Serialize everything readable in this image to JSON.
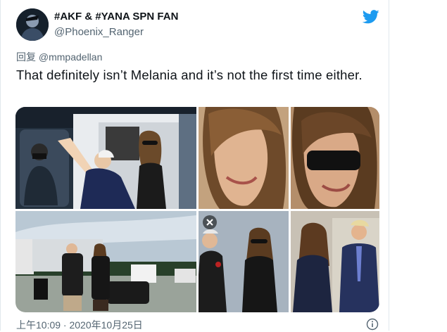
{
  "tweet": {
    "display_name": "#AKF & #YANA SPN FAN",
    "handle": "@Phoenix_Ranger",
    "reply_prefix": "回复",
    "reply_to": "@mmpadellan",
    "text": "That definitely isn’t Melania and it’s not the first time either.",
    "timestamp": "上午10:09 · 2020年10月25日"
  },
  "icons": {
    "brand": "twitter-bird-icon",
    "info": "info-icon",
    "remove": "close-icon"
  },
  "colors": {
    "twitter_blue": "#1d9bf0",
    "secondary_text": "#536471",
    "primary_text": "#0f1419"
  }
}
